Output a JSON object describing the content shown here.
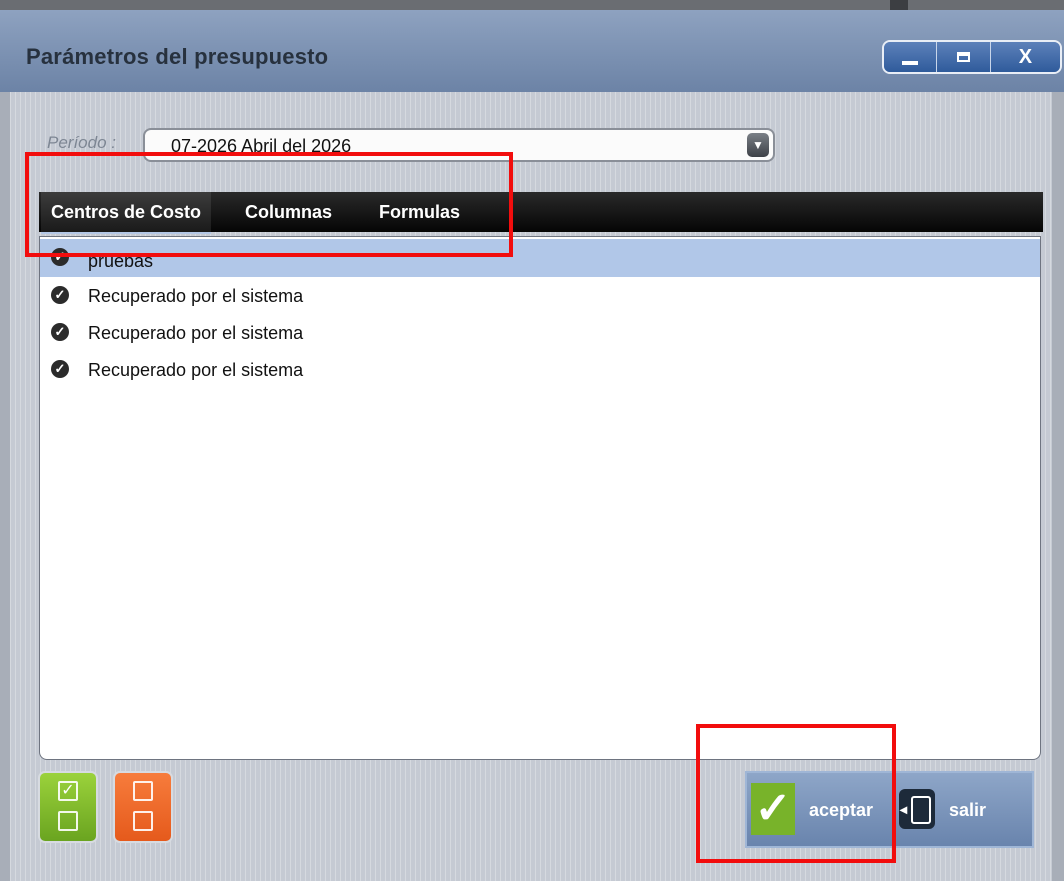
{
  "window": {
    "title": "Parámetros del presupuesto",
    "controls": {
      "minimize": "minimize-icon",
      "maximize": "maximize-icon",
      "close": "X"
    }
  },
  "period": {
    "label": "Período :",
    "value": "07-2026 Abril del 2026"
  },
  "tabs": [
    {
      "label": "Centros de Costo",
      "active": true
    },
    {
      "label": "Columnas",
      "active": false
    },
    {
      "label": "Formulas",
      "active": false
    }
  ],
  "list": {
    "items": [
      {
        "label": "pruebas",
        "checked": true,
        "selected": true
      },
      {
        "label": "Recuperado por el sistema",
        "checked": true,
        "selected": false
      },
      {
        "label": "Recuperado por el sistema",
        "checked": true,
        "selected": false
      },
      {
        "label": "Recuperado por el sistema",
        "checked": true,
        "selected": false
      }
    ]
  },
  "buttons": {
    "check_all": "checklist-check-icon",
    "uncheck_all": "checklist-empty-icon",
    "accept": "aceptar",
    "exit": "salir"
  },
  "colors": {
    "title_bar": "#7d93b5",
    "selected_row": "#b1c7e8",
    "annotation_box": "#f20d0d",
    "accept_green": "#78b32a",
    "uncheck_orange": "#ee6a2a"
  }
}
